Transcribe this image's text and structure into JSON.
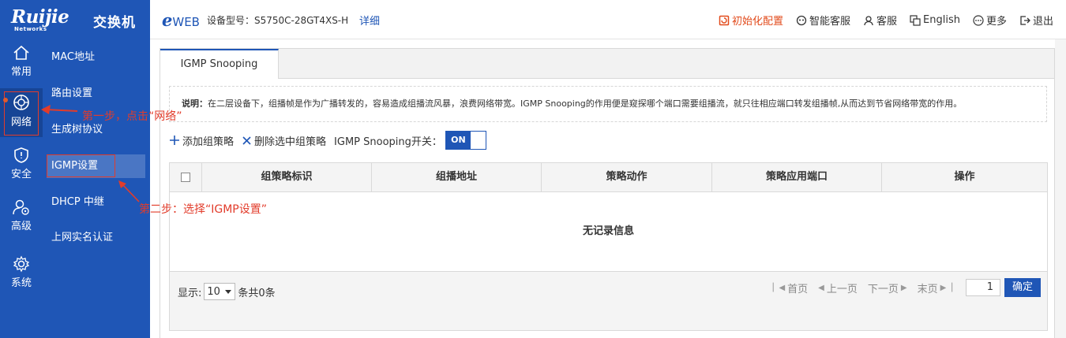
{
  "brand": {
    "logo": "Ruijie",
    "logo_sub": "Networks",
    "product": "交换机"
  },
  "header": {
    "eweb_e": "e",
    "eweb_text": "WEB",
    "model_label": "设备型号：S5750C-28GT4XS-H",
    "detail_link": "详细",
    "nav": [
      {
        "label": "初始化配置",
        "icon": "reset-icon"
      },
      {
        "label": "智能客服",
        "icon": "robot-icon"
      },
      {
        "label": "客服",
        "icon": "user-icon"
      },
      {
        "label": "English",
        "icon": "language-icon"
      },
      {
        "label": "更多",
        "icon": "more-icon"
      },
      {
        "label": "退出",
        "icon": "logout-icon"
      }
    ]
  },
  "iconbar": [
    {
      "label": "常用",
      "icon": "home-icon"
    },
    {
      "label": "网络",
      "icon": "network-icon",
      "active": true
    },
    {
      "label": "安全",
      "icon": "shield-icon"
    },
    {
      "label": "高级",
      "icon": "advanced-user-icon"
    },
    {
      "label": "系统",
      "icon": "gear-icon"
    }
  ],
  "submenu": [
    {
      "label": "MAC地址"
    },
    {
      "label": "路由设置"
    },
    {
      "label": "生成树协议"
    },
    {
      "label": "IGMP设置",
      "active": true
    },
    {
      "label": "DHCP 中继"
    },
    {
      "label": "上网实名认证"
    }
  ],
  "main": {
    "tab_label": "IGMP Snooping",
    "desc_prefix": "说明：",
    "desc_text": "在二层设备下，组播帧是作为广播转发的，容易造成组播流风暴，浪费网络带宽。IGMP Snooping的作用便是窥探哪个端口需要组播流，就只往相应端口转发组播帧,从而达到节省网络带宽的作用。",
    "add_label": "添加组策略",
    "delete_label": "删除选中组策略",
    "switch_label": "IGMP Snooping开关：",
    "switch_state": "ON",
    "table": {
      "columns": [
        "组策略标识",
        "组播地址",
        "策略动作",
        "策略应用端口",
        "操作"
      ],
      "empty_text": "无记录信息"
    },
    "pager": {
      "show_label": "显示:",
      "page_size": "10",
      "total_text": "条共0条",
      "first": "首页",
      "prev": "上一页",
      "next": "下一页",
      "last": "末页",
      "page_value": "1",
      "confirm": "确定"
    }
  },
  "annotations": {
    "step1": "第一步，点击“网络”",
    "step2": "第二步：选择“IGMP设置”"
  },
  "colors": {
    "primary": "#1f56b6",
    "highlight": "#e23c2b",
    "hot": "#e24b1c"
  }
}
